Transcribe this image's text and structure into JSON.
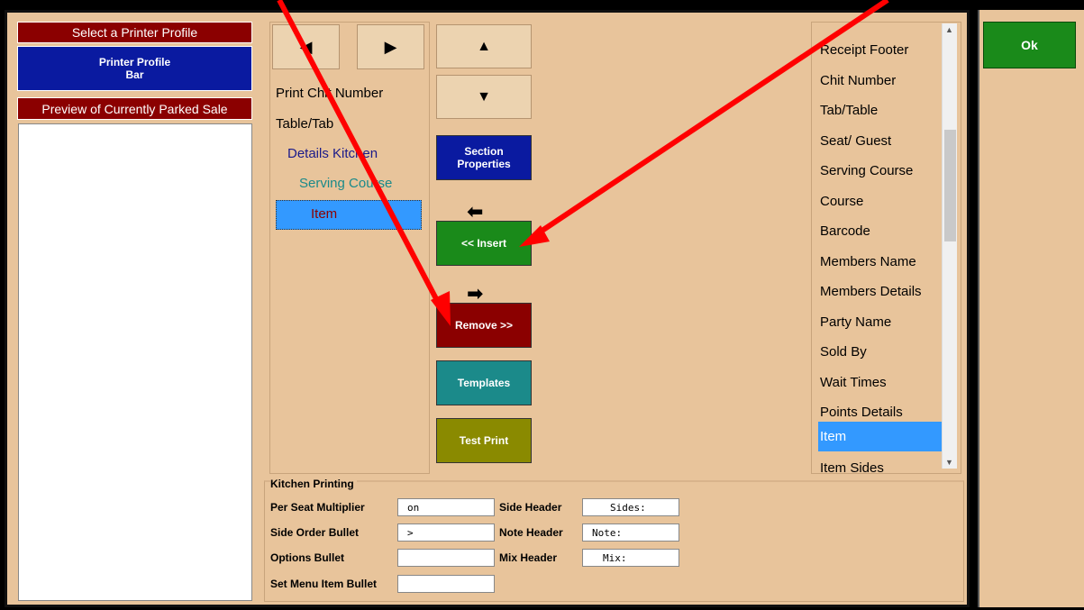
{
  "left": {
    "select_profile": "Select a Printer Profile",
    "profile_line1": "Printer Profile",
    "profile_line2": "Bar",
    "preview_header": "Preview of Currently Parked Sale"
  },
  "tree": {
    "items": [
      "Print Chit Number",
      "Table/Tab",
      "Details Kitchen",
      "Serving Course",
      "Item"
    ]
  },
  "buttons": {
    "section_properties_1": "Section",
    "section_properties_2": "Properties",
    "insert": "<< Insert",
    "remove": "Remove >>",
    "templates": "Templates",
    "test_print": "Test Print",
    "ok": "Ok"
  },
  "list": {
    "items": [
      "Receipt Footer",
      "Chit Number",
      "Tab/Table",
      "Seat/ Guest",
      "Serving Course",
      "Course",
      "Barcode",
      "Members Name",
      "Members Details",
      "Party Name",
      "Sold By",
      "Wait Times",
      "Points Details",
      "Item",
      "Item Sides"
    ]
  },
  "kitchen": {
    "title": "Kitchen Printing",
    "per_seat_label": "Per Seat Multiplier",
    "per_seat_value": "on",
    "side_order_label": "Side Order Bullet",
    "side_order_value": ">",
    "options_label": "Options Bullet",
    "options_value": "",
    "set_menu_label": "Set Menu Item Bullet",
    "set_menu_value": "",
    "side_header_label": "Side Header",
    "side_header_value": "Sides:",
    "note_header_label": "Note Header",
    "note_header_value": "Note:",
    "mix_header_label": "Mix Header",
    "mix_header_value": "Mix:"
  },
  "colors": {
    "panel": "#e8c49b",
    "header_red": "#8b0000",
    "profile_blue": "#0a1aa0",
    "insert_green": "#1a8a1a",
    "remove_red": "#8b0000",
    "templates_teal": "#1b8a8a",
    "testprint_olive": "#8a8a00",
    "selection_blue": "#3399ff",
    "annotation_red": "#ff0000"
  }
}
